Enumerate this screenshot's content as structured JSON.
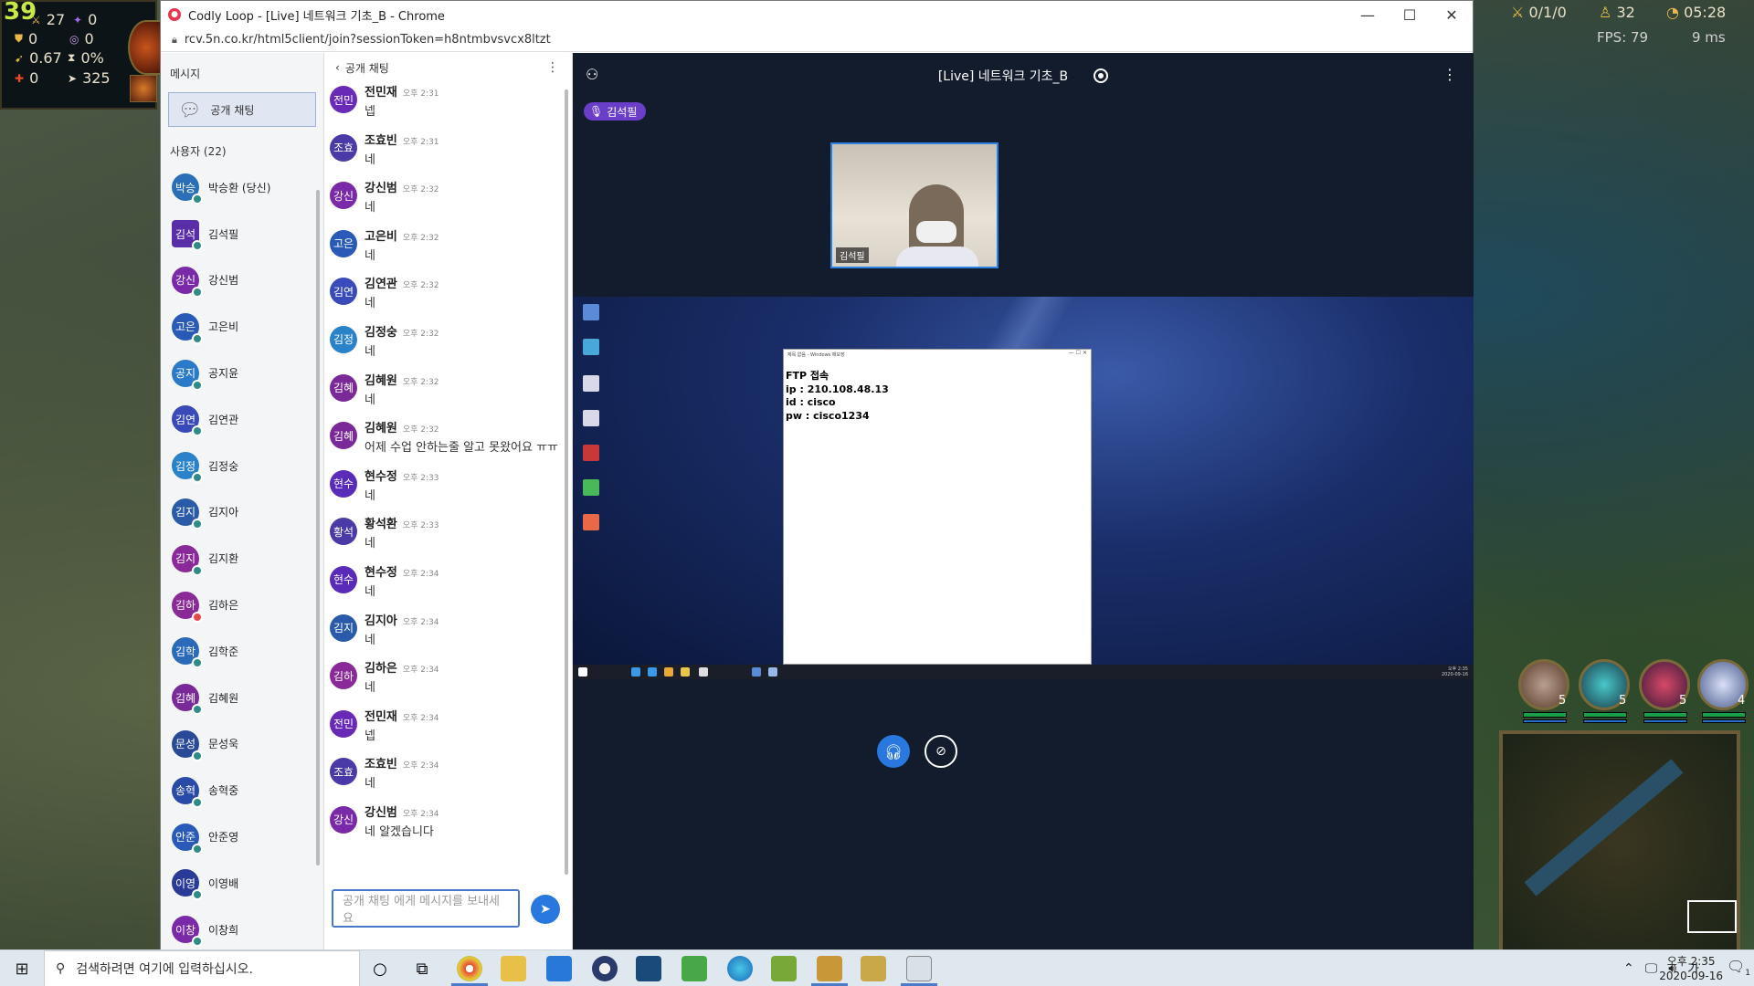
{
  "game": {
    "level": "39",
    "stats": [
      {
        "icon": "sword-icon",
        "value": "27"
      },
      {
        "icon": "magic-icon",
        "value": "0"
      },
      {
        "icon": "armor-icon",
        "value": "0"
      },
      {
        "icon": "mr-icon",
        "value": "0"
      },
      {
        "icon": "attack-speed-icon",
        "value": "0.67"
      },
      {
        "icon": "cdr-icon",
        "value": "0%"
      },
      {
        "icon": "crit-icon",
        "value": "0"
      },
      {
        "icon": "move-speed-icon",
        "value": "325"
      }
    ],
    "kda": "0/1/0",
    "cs": "32",
    "time": "05:28",
    "fps": "FPS: 79",
    "ping": "9 ms",
    "team_levels": [
      "5",
      "5",
      "5",
      "4"
    ]
  },
  "window": {
    "title": "Codly Loop - [Live] 네트워크 기초_B - Chrome",
    "url": "rcv.5n.co.kr/html5client/join?sessionToken=h8ntmbvsvcx8ltzt"
  },
  "sidebar": {
    "messages_header": "메시지",
    "public_chat": "공개 채팅",
    "users_header": "사용자 (22)",
    "users": [
      {
        "initials": "박승",
        "name": "박승환 (당신)",
        "color": "#2a6fb8",
        "dot": "normal"
      },
      {
        "initials": "김석",
        "name": "김석필",
        "color": "#5a2ea8",
        "dot": "normal",
        "square": true
      },
      {
        "initials": "강신",
        "name": "강신범",
        "color": "#7a2aa8",
        "dot": "normal"
      },
      {
        "initials": "고은",
        "name": "고은비",
        "color": "#2a5ab8",
        "dot": "normal"
      },
      {
        "initials": "공지",
        "name": "공지윤",
        "color": "#2a7ac8",
        "dot": "normal"
      },
      {
        "initials": "김연",
        "name": "김연관",
        "color": "#3a4ab8",
        "dot": "normal"
      },
      {
        "initials": "김정",
        "name": "김정숭",
        "color": "#2a82c8",
        "dot": "normal"
      },
      {
        "initials": "김지",
        "name": "김지아",
        "color": "#2a5aa8",
        "dot": "normal"
      },
      {
        "initials": "김지",
        "name": "김지환",
        "color": "#8a2a9a",
        "dot": "normal"
      },
      {
        "initials": "김하",
        "name": "김하은",
        "color": "#8a2a98",
        "dot": "red"
      },
      {
        "initials": "김학",
        "name": "김학준",
        "color": "#2a6ab8",
        "dot": "normal"
      },
      {
        "initials": "김혜",
        "name": "김혜원",
        "color": "#7a2a98",
        "dot": "normal"
      },
      {
        "initials": "문성",
        "name": "문성욱",
        "color": "#2a4a98",
        "dot": "normal"
      },
      {
        "initials": "송혁",
        "name": "송혁중",
        "color": "#2a4aa8",
        "dot": "normal"
      },
      {
        "initials": "안준",
        "name": "안준영",
        "color": "#2a5ab8",
        "dot": "normal"
      },
      {
        "initials": "이영",
        "name": "이영배",
        "color": "#2a3a98",
        "dot": "normal"
      },
      {
        "initials": "이창",
        "name": "이창희",
        "color": "#7a2aa8",
        "dot": "normal"
      }
    ]
  },
  "chat": {
    "title": "공개 채팅",
    "input_placeholder": "공개 채팅 에게 메시지를 보내세요",
    "messages": [
      {
        "initials": "전민",
        "name": "전민재",
        "time": "오후 2:31",
        "text": "넵",
        "color": "#6a2ab8"
      },
      {
        "initials": "조효",
        "name": "조효빈",
        "time": "오후 2:31",
        "text": "네",
        "color": "#4a3aa8"
      },
      {
        "initials": "강신",
        "name": "강신범",
        "time": "오후 2:32",
        "text": "네",
        "color": "#7a2aa8"
      },
      {
        "initials": "고은",
        "name": "고은비",
        "time": "오후 2:32",
        "text": "네",
        "color": "#2a5ab8"
      },
      {
        "initials": "김연",
        "name": "김연관",
        "time": "오후 2:32",
        "text": "네",
        "color": "#3a4ab8"
      },
      {
        "initials": "김정",
        "name": "김정숭",
        "time": "오후 2:32",
        "text": "네",
        "color": "#2a82c8"
      },
      {
        "initials": "김혜",
        "name": "김혜원",
        "time": "오후 2:32",
        "text": "네",
        "color": "#7a2a98"
      },
      {
        "initials": "김혜",
        "name": "김혜원",
        "time": "오후 2:32",
        "text": "어제 수업 안하는줄 알고 못왔어요 ㅠㅠ",
        "color": "#7a2a98"
      },
      {
        "initials": "현수",
        "name": "현수정",
        "time": "오후 2:33",
        "text": "네",
        "color": "#5a2ab8"
      },
      {
        "initials": "황석",
        "name": "황석환",
        "time": "오후 2:33",
        "text": "네",
        "color": "#4a3aa8"
      },
      {
        "initials": "현수",
        "name": "현수정",
        "time": "오후 2:34",
        "text": "네",
        "color": "#5a2ab8"
      },
      {
        "initials": "김지",
        "name": "김지아",
        "time": "오후 2:34",
        "text": "네",
        "color": "#2a5aa8"
      },
      {
        "initials": "김하",
        "name": "김하은",
        "time": "오후 2:34",
        "text": "네",
        "color": "#8a2a98"
      },
      {
        "initials": "전민",
        "name": "전민재",
        "time": "오후 2:34",
        "text": "넵",
        "color": "#6a2ab8"
      },
      {
        "initials": "조효",
        "name": "조효빈",
        "time": "오후 2:34",
        "text": "네",
        "color": "#4a3aa8"
      },
      {
        "initials": "강신",
        "name": "강신범",
        "time": "오후 2:34",
        "text": "네 알겠습니다",
        "color": "#7a2aa8"
      }
    ]
  },
  "stage": {
    "title": "[Live] 네트워크 기초_B",
    "presenter": "김석필",
    "video_name": "김석필",
    "notepad_title": "제목 없음 - Windows 메모장",
    "notepad_lines": [
      "FTP 접속",
      "ip : 210.108.48.13",
      "id : cisco",
      "pw : cisco1234"
    ],
    "remote_clock_time": "오후 2:35",
    "remote_clock_date": "2020-09-16"
  },
  "taskbar": {
    "search_placeholder": "검색하려면 여기에 입력하십시오.",
    "ime": "가",
    "time": "오후 2:35",
    "date": "2020-09-16",
    "notification_count": "1"
  }
}
